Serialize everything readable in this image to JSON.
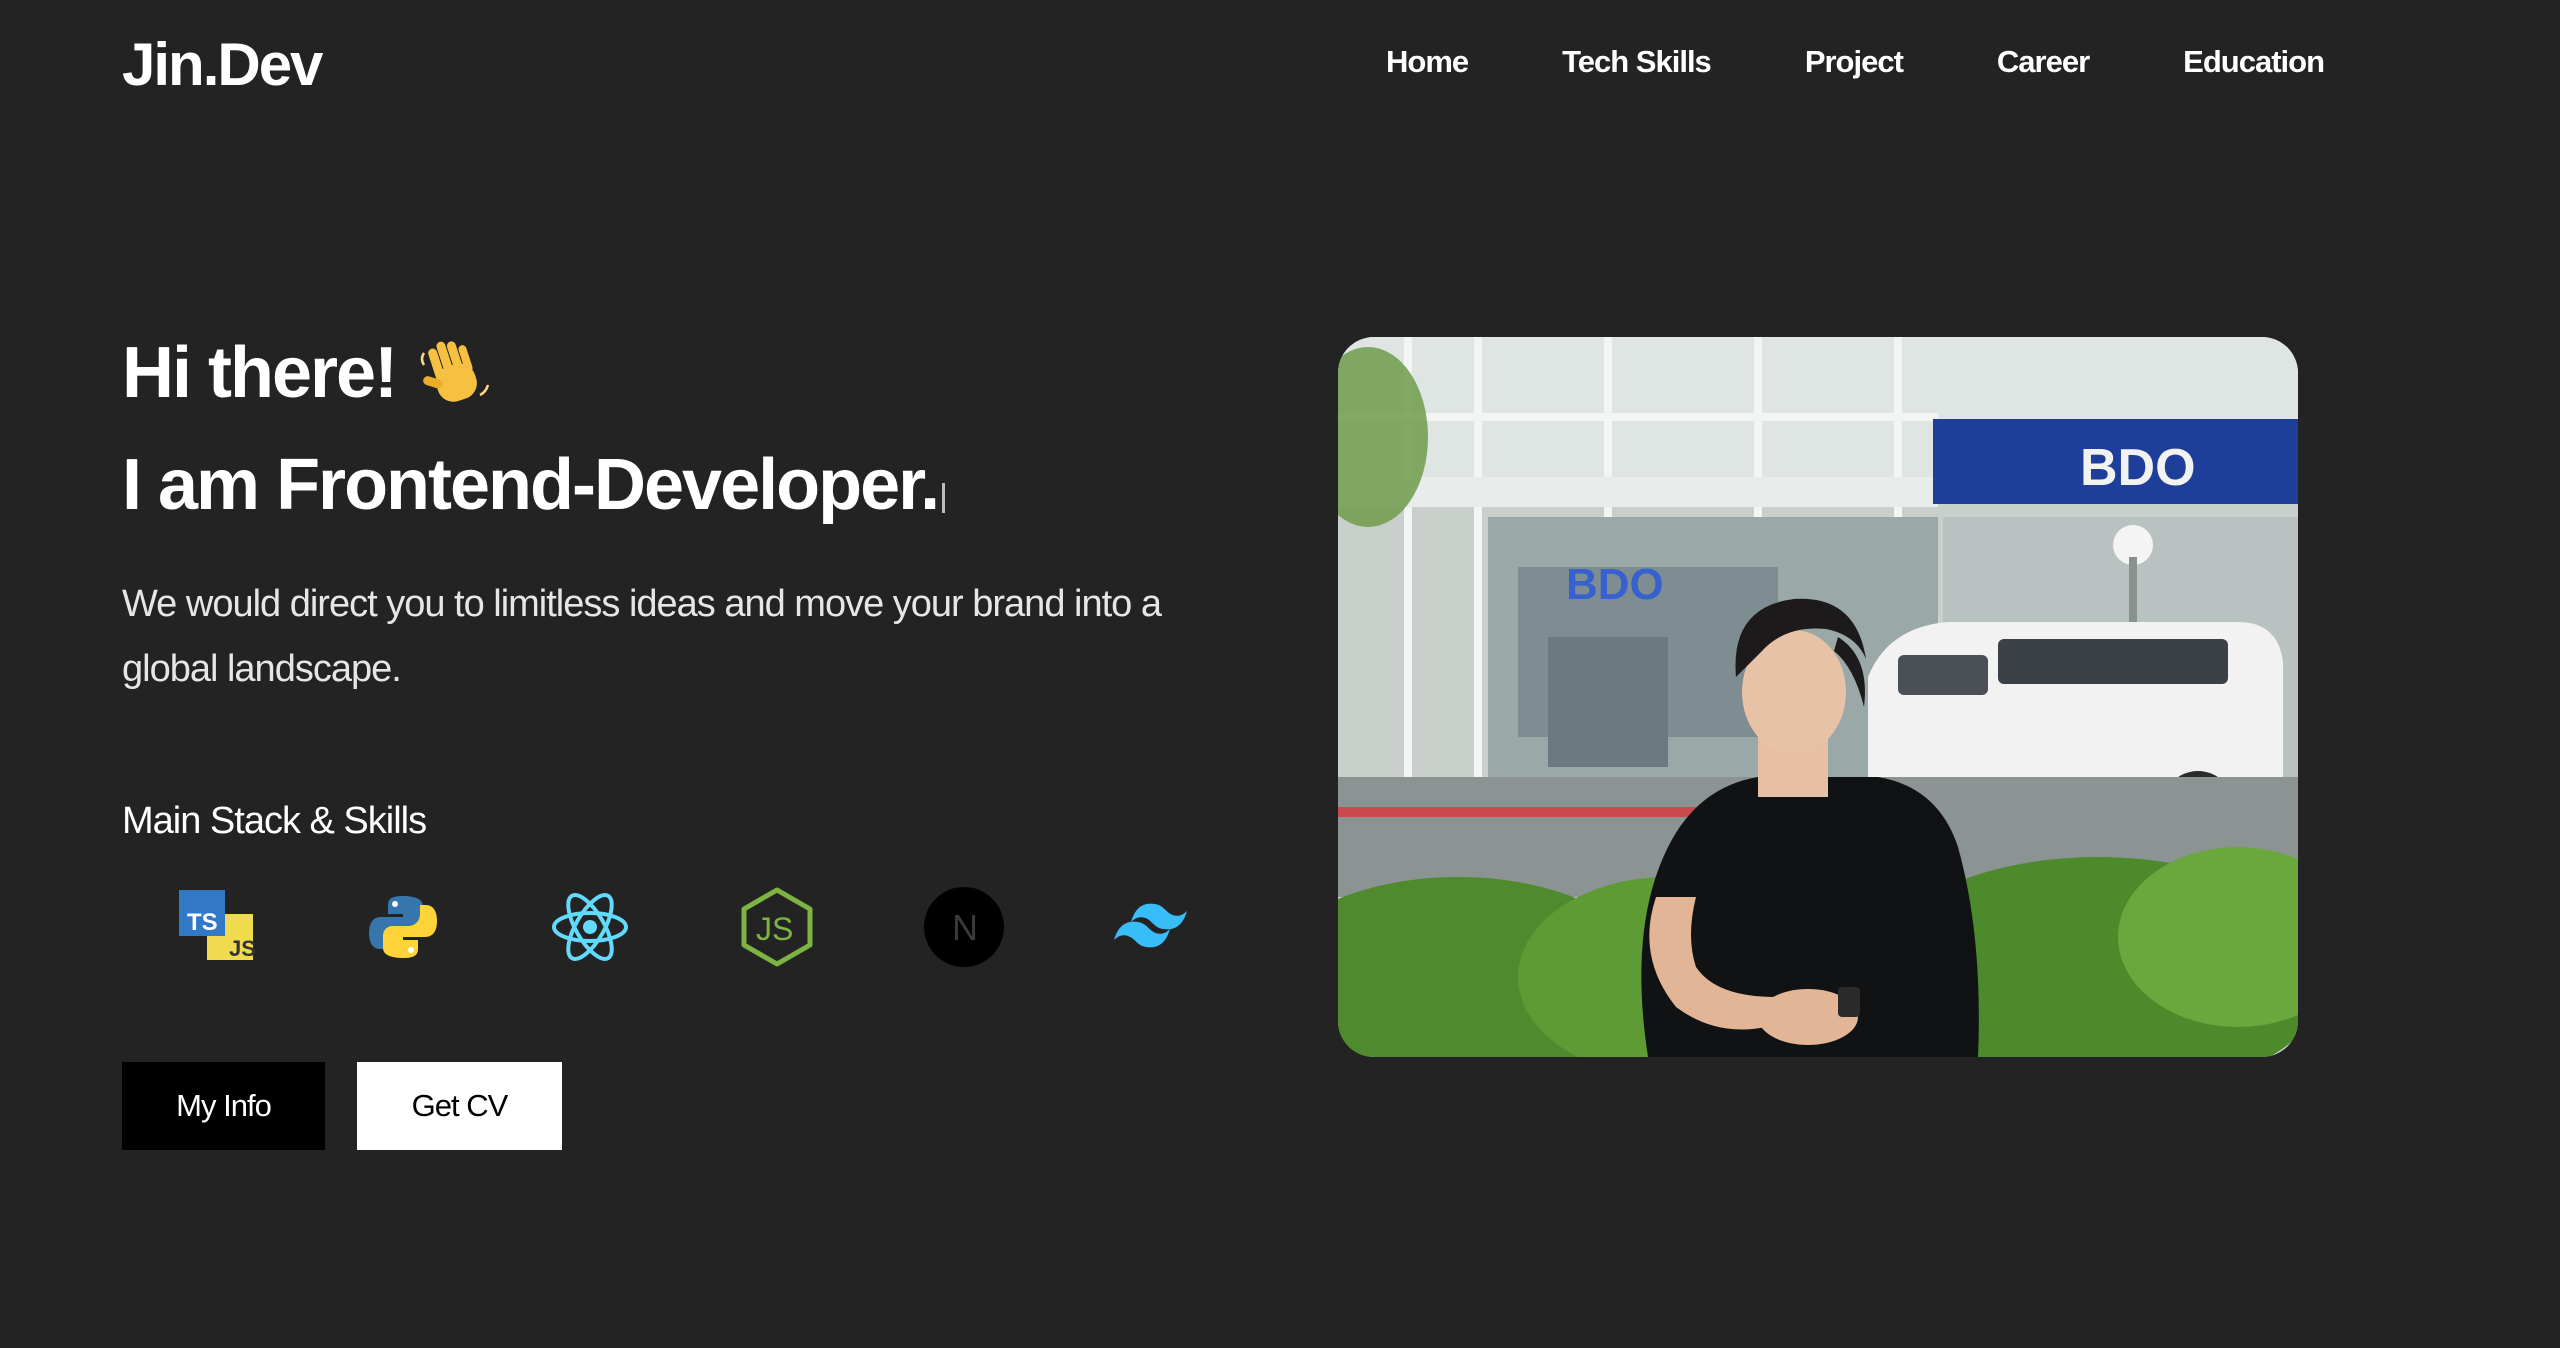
{
  "header": {
    "logo": "Jin.Dev",
    "nav": [
      {
        "label": "Home"
      },
      {
        "label": "Tech Skills"
      },
      {
        "label": "Project"
      },
      {
        "label": "Career"
      },
      {
        "label": "Education"
      }
    ]
  },
  "hero": {
    "greeting": "Hi there!",
    "greeting_icon": "waving-hand-icon",
    "role": "I am Frontend-Developer.",
    "tagline": "We would direct you to limitless ideas and move your brand into a global landscape.",
    "stack_title": "Main Stack & Skills",
    "skills": [
      {
        "icon": "typescript-javascript-icon",
        "ts_label": "TS",
        "js_label": "JS"
      },
      {
        "icon": "python-icon"
      },
      {
        "icon": "react-icon"
      },
      {
        "icon": "nodejs-icon",
        "label": "JS"
      },
      {
        "icon": "nextjs-icon",
        "label": "N"
      },
      {
        "icon": "tailwind-icon"
      }
    ],
    "buttons": {
      "info": "My Info",
      "cv": "Get CV"
    },
    "photo": {
      "sign_text": "BDO"
    }
  },
  "colors": {
    "background": "#232323",
    "text": "#ffffff",
    "button_dark": "#000000",
    "button_light": "#ffffff"
  }
}
